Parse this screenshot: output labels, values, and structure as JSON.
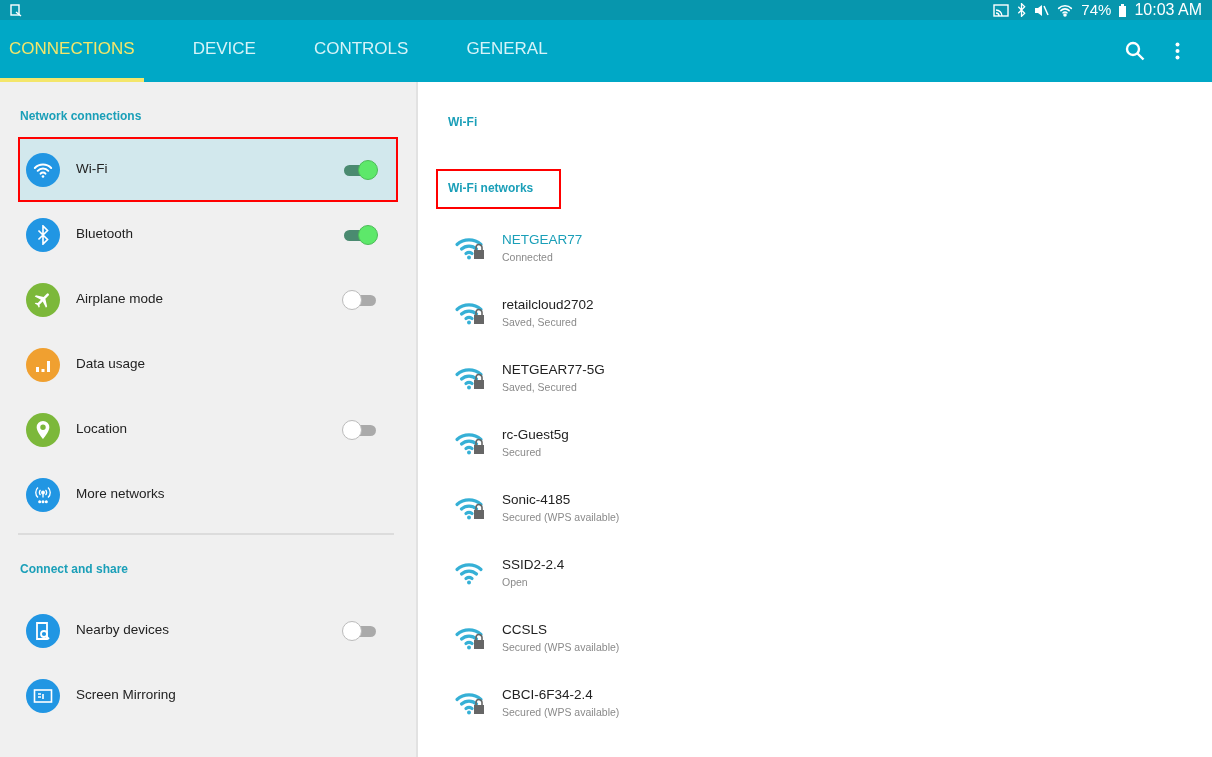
{
  "status_bar": {
    "battery": "74%",
    "time": "10:03 AM"
  },
  "tabs": [
    {
      "label": "CONNECTIONS",
      "selected": true
    },
    {
      "label": "DEVICE",
      "selected": false
    },
    {
      "label": "CONTROLS",
      "selected": false
    },
    {
      "label": "GENERAL",
      "selected": false
    }
  ],
  "sidebar": {
    "sections": [
      {
        "title": "Network connections",
        "items": [
          {
            "label": "Wi-Fi",
            "color": "#2196e3",
            "kind": "toggle",
            "on": true,
            "selected": true,
            "highlighted": true
          },
          {
            "label": "Bluetooth",
            "color": "#2196e3",
            "kind": "toggle",
            "on": true,
            "selected": false,
            "highlighted": false
          },
          {
            "label": "Airplane mode",
            "color": "#7cb83a",
            "kind": "toggle",
            "on": false,
            "selected": false,
            "highlighted": false
          },
          {
            "label": "Data usage",
            "color": "#f0a030",
            "kind": "plain",
            "selected": false,
            "highlighted": false
          },
          {
            "label": "Location",
            "color": "#7cb83a",
            "kind": "toggle",
            "on": false,
            "selected": false,
            "highlighted": false
          },
          {
            "label": "More networks",
            "color": "#2196e3",
            "kind": "plain",
            "selected": false,
            "highlighted": false
          }
        ]
      },
      {
        "title": "Connect and share",
        "items": [
          {
            "label": "Nearby devices",
            "color": "#2196e3",
            "kind": "toggle",
            "on": false,
            "selected": false,
            "highlighted": false
          },
          {
            "label": "Screen Mirroring",
            "color": "#2196e3",
            "kind": "plain",
            "selected": false,
            "highlighted": false
          }
        ]
      }
    ]
  },
  "detail": {
    "title": "Wi-Fi",
    "networks_header": {
      "label": "Wi-Fi networks",
      "highlighted": true
    },
    "networks": [
      {
        "name": "NETGEAR77",
        "status": "Connected",
        "secured": true,
        "connected": true
      },
      {
        "name": "retailcloud2702",
        "status": "Saved, Secured",
        "secured": true,
        "connected": false
      },
      {
        "name": "NETGEAR77-5G",
        "status": "Saved, Secured",
        "secured": true,
        "connected": false
      },
      {
        "name": "rc-Guest5g",
        "status": "Secured",
        "secured": true,
        "connected": false
      },
      {
        "name": "Sonic-4185",
        "status": "Secured (WPS available)",
        "secured": true,
        "connected": false
      },
      {
        "name": "SSID2-2.4",
        "status": "Open",
        "secured": false,
        "connected": false
      },
      {
        "name": "CCSLS",
        "status": "Secured (WPS available)",
        "secured": true,
        "connected": false
      },
      {
        "name": "CBCI-6F34-2.4",
        "status": "Secured (WPS available)",
        "secured": true,
        "connected": false
      }
    ]
  }
}
